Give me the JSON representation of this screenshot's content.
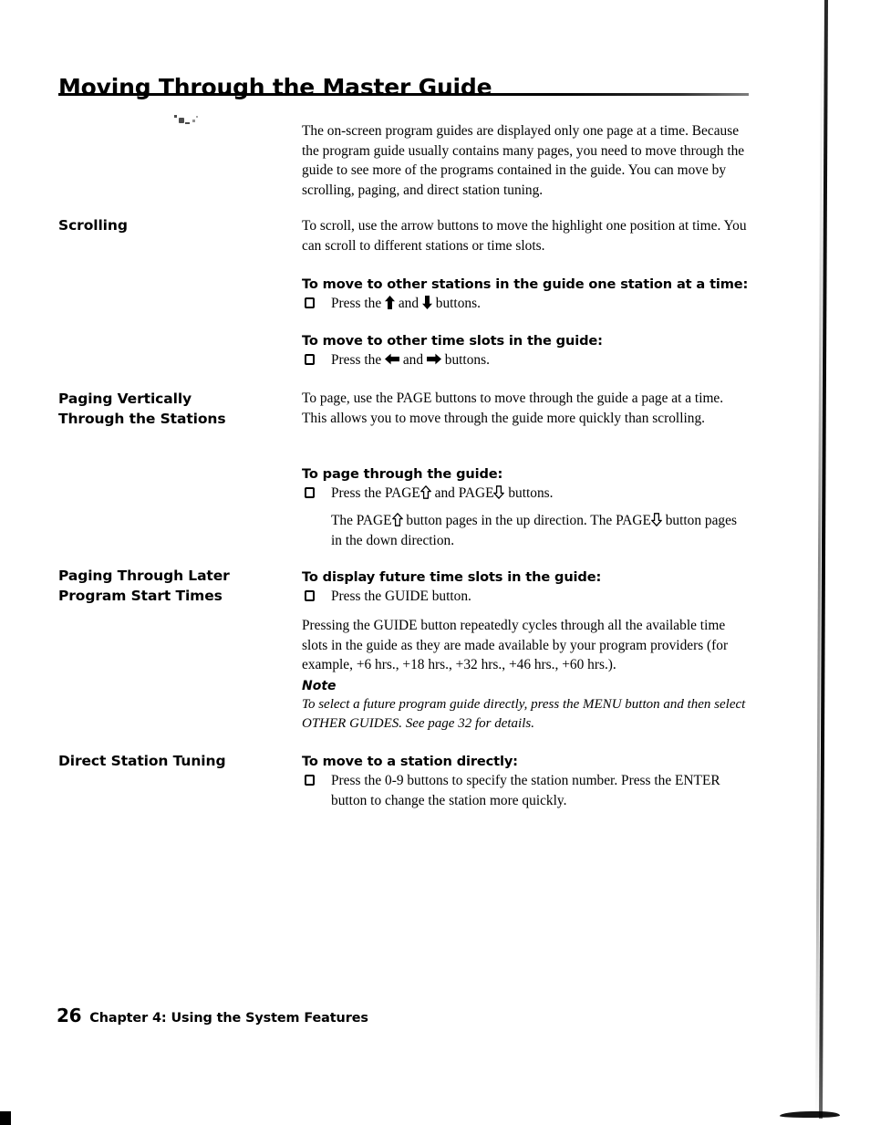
{
  "page": {
    "title": "Moving Through the Master Guide",
    "intro": "The on-screen program guides are displayed only one page at a time. Because the program guide usually contains many pages, you need to move through the guide to see more of the programs contained in the guide. You can move by scrolling, paging, and direct station tuning."
  },
  "sections": {
    "scrolling": {
      "heading": "Scrolling",
      "body": "To scroll, use the arrow buttons to move the highlight one position at time. You can scroll to different stations or time slots.",
      "subhead_stations": "To move to other stations in the guide one station at a time:",
      "bullet_stations_pre": "Press the ",
      "bullet_stations_mid": " and ",
      "bullet_stations_post": " buttons.",
      "subhead_timeslots": "To move to other time slots in the guide:",
      "bullet_timeslots_pre": "Press the ",
      "bullet_timeslots_mid": " and ",
      "bullet_timeslots_post": " buttons."
    },
    "paging_vertically": {
      "heading_line1": "Paging Vertically",
      "heading_line2": "Through the Stations",
      "body": "To page, use the PAGE buttons to move through the guide a page at a time. This allows you to move through the guide more quickly than scrolling.",
      "subhead": "To page through the guide:",
      "bullet_pre": "Press the PAGE",
      "bullet_mid": " and PAGE",
      "bullet_post": " buttons.",
      "explain_pre": "The PAGE",
      "explain_mid": " button pages in the up direction. The PAGE",
      "explain_post": " button pages in the down direction."
    },
    "paging_later": {
      "heading_line1": "Paging Through Later",
      "heading_line2": "Program Start Times",
      "subhead": "To display future time slots in the guide:",
      "bullet": "Press the GUIDE button.",
      "body": "Pressing the GUIDE button repeatedly cycles through all the available time slots in the guide as they are made available by your program providers (for example, +6 hrs., +18 hrs., +32 hrs., +46 hrs., +60 hrs.).",
      "note_label": "Note",
      "note_body": "To select a future program guide directly, press the MENU button and then select OTHER GUIDES. See page 32 for details."
    },
    "direct_tuning": {
      "heading": "Direct Station Tuning",
      "subhead": "To move to a station directly:",
      "bullet": "Press the 0-9 buttons to specify the station number. Press the ENTER button to change the station more quickly."
    }
  },
  "footer": {
    "page_number": "26",
    "chapter": "Chapter 4: Using the System Features"
  },
  "icons": {
    "arrow_up": "arrow-up-solid-icon",
    "arrow_down": "arrow-down-solid-icon",
    "arrow_left": "arrow-left-solid-icon",
    "arrow_right": "arrow-right-solid-icon",
    "page_up": "arrow-up-outline-icon",
    "page_down": "arrow-down-outline-icon",
    "bullet": "checkbox-square-icon"
  },
  "colors": {
    "text": "#000000",
    "background": "#ffffff"
  }
}
